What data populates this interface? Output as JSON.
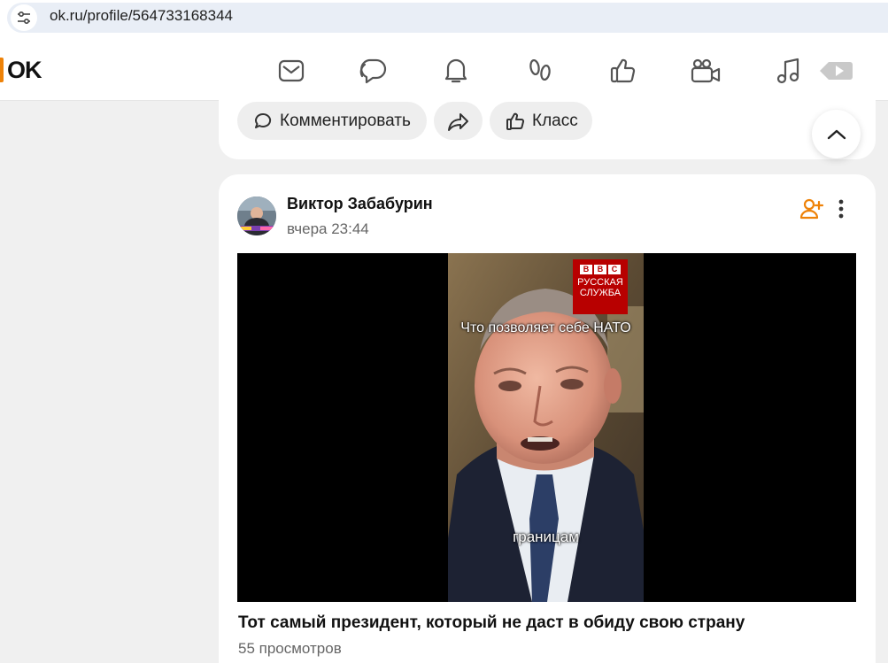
{
  "browser": {
    "url": "ok.ru/profile/564733168344",
    "site_icon": "tune-icon"
  },
  "header": {
    "logo_text": "OK",
    "nav_icons": [
      "mail-icon",
      "chat-icon",
      "bell-icon",
      "guests-icon",
      "like-icon",
      "video-camera-icon",
      "music-icon",
      "play-icon"
    ]
  },
  "prev_post": {
    "comment_label": "Комментировать",
    "share_icon": "share-icon",
    "class_label": "Класс"
  },
  "post": {
    "author": "Виктор Забабурин",
    "time": "вчера 23:44",
    "video": {
      "badge_letters": [
        "B",
        "B",
        "C"
      ],
      "badge_line1": "РУССКАЯ",
      "badge_line2": "СЛУЖБА",
      "subtitle_top": "Что позволяет себе НАТО",
      "subtitle_bottom": "границам"
    },
    "title": "Тот самый президент, который не даст в обиду свою страну",
    "views": "55 просмотров"
  },
  "colors": {
    "accent": "#ee8208",
    "background": "#f0f0f0",
    "card": "#ffffff",
    "button": "#eeeeee"
  }
}
